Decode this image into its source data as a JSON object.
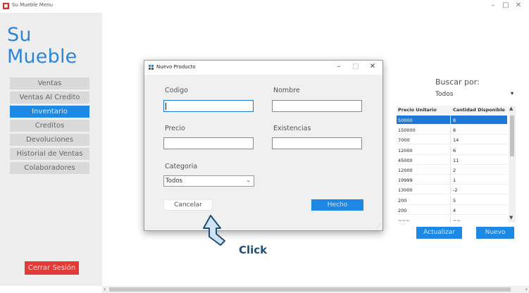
{
  "window": {
    "title": "Su Mueble Menu",
    "icon": "app-icon",
    "controls": {
      "minimize": "–",
      "maximize": "▢",
      "close": "✕"
    }
  },
  "sidebar": {
    "brand": "Su Mueble",
    "items": [
      {
        "label": "Ventas",
        "active": false
      },
      {
        "label": "Ventas Al Credito",
        "active": false
      },
      {
        "label": "Inventario",
        "active": true
      },
      {
        "label": "Creditos",
        "active": false
      },
      {
        "label": "Devoluciones",
        "active": false
      },
      {
        "label": "Historial de Ventas",
        "active": false
      },
      {
        "label": "Colaboradores",
        "active": false
      }
    ],
    "logout_label": "Cerrar Sesión"
  },
  "search": {
    "label": "Buscar por:",
    "selected": "Todos"
  },
  "grid": {
    "columns": [
      "Precio Unitario",
      "Cantidad Disponible"
    ],
    "rows": [
      {
        "precio": "50000",
        "cantidad": "8",
        "selected": true
      },
      {
        "precio": "150000",
        "cantidad": "8",
        "selected": false
      },
      {
        "precio": "7000",
        "cantidad": "14",
        "selected": false
      },
      {
        "precio": "12000",
        "cantidad": "6",
        "selected": false
      },
      {
        "precio": "45000",
        "cantidad": "11",
        "selected": false
      },
      {
        "precio": "12000",
        "cantidad": "2",
        "selected": false
      },
      {
        "precio": "19999",
        "cantidad": "1",
        "selected": false
      },
      {
        "precio": "13000",
        "cantidad": "-2",
        "selected": false
      },
      {
        "precio": "200",
        "cantidad": "5",
        "selected": false
      },
      {
        "precio": "200",
        "cantidad": "4",
        "selected": false
      },
      {
        "precio": "~~~",
        "cantidad": "~~",
        "selected": false
      }
    ]
  },
  "actions": {
    "refresh_label": "Actualizar",
    "new_label": "Nuevo"
  },
  "dialog": {
    "title": "Nuevo Producto",
    "controls": {
      "minimize": "–",
      "maximize": "□",
      "close": "✕"
    },
    "fields": {
      "codigo_label": "Codigo",
      "codigo_value": "",
      "nombre_label": "Nombre",
      "nombre_value": "",
      "precio_label": "Precio",
      "precio_value": "",
      "existencias_label": "Existencias",
      "existencias_value": "",
      "categoria_label": "Categoria",
      "categoria_value": "Todos"
    },
    "cancel_label": "Cancelar",
    "done_label": "Hecho"
  },
  "annotation": {
    "label": "Click",
    "arrow_icon": "up-arrow-icon"
  },
  "colors": {
    "accent": "#1e88e5",
    "danger": "#e53935",
    "brand": "#2e86d6",
    "annotation": "#1f4e79"
  }
}
